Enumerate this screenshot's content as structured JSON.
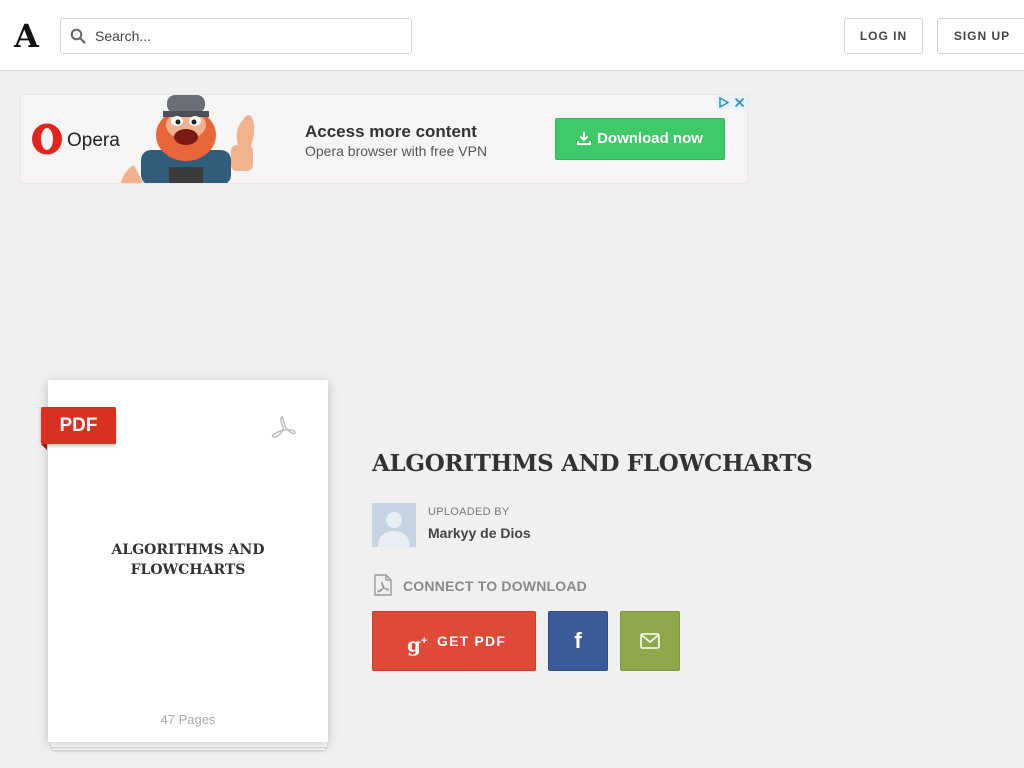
{
  "header": {
    "logo": "A",
    "search_placeholder": "Search...",
    "login_label": "LOG IN",
    "signup_label": "SIGN UP"
  },
  "ad": {
    "brand": "Opera",
    "headline": "Access more content",
    "subline": "Opera browser with free VPN",
    "cta_label": "Download now",
    "colors": {
      "cta": "#3fc968",
      "brand_red": "#e0261c"
    }
  },
  "document": {
    "badge": "PDF",
    "cover_title_line1": "ALGORITHMS AND",
    "cover_title_line2": "FLOWCHARTS",
    "pages": "47 Pages",
    "title": "ALGORITHMS AND FLOWCHARTS",
    "uploaded_by_label": "UPLOADED BY",
    "uploader": "Markyy de Dios",
    "connect_label": "CONNECT TO DOWNLOAD",
    "get_pdf_label": "GET PDF",
    "facebook_glyph": "f",
    "icons": [
      "search-icon",
      "download-icon",
      "acrobat-icon",
      "user-avatar-icon",
      "pdf-file-icon",
      "google-plus-icon",
      "facebook-icon",
      "mail-icon"
    ],
    "colors": {
      "get_pdf": "#df4a37",
      "facebook": "#3b5a9a",
      "mail": "#8fa84a",
      "badge": "#d9301f"
    }
  }
}
